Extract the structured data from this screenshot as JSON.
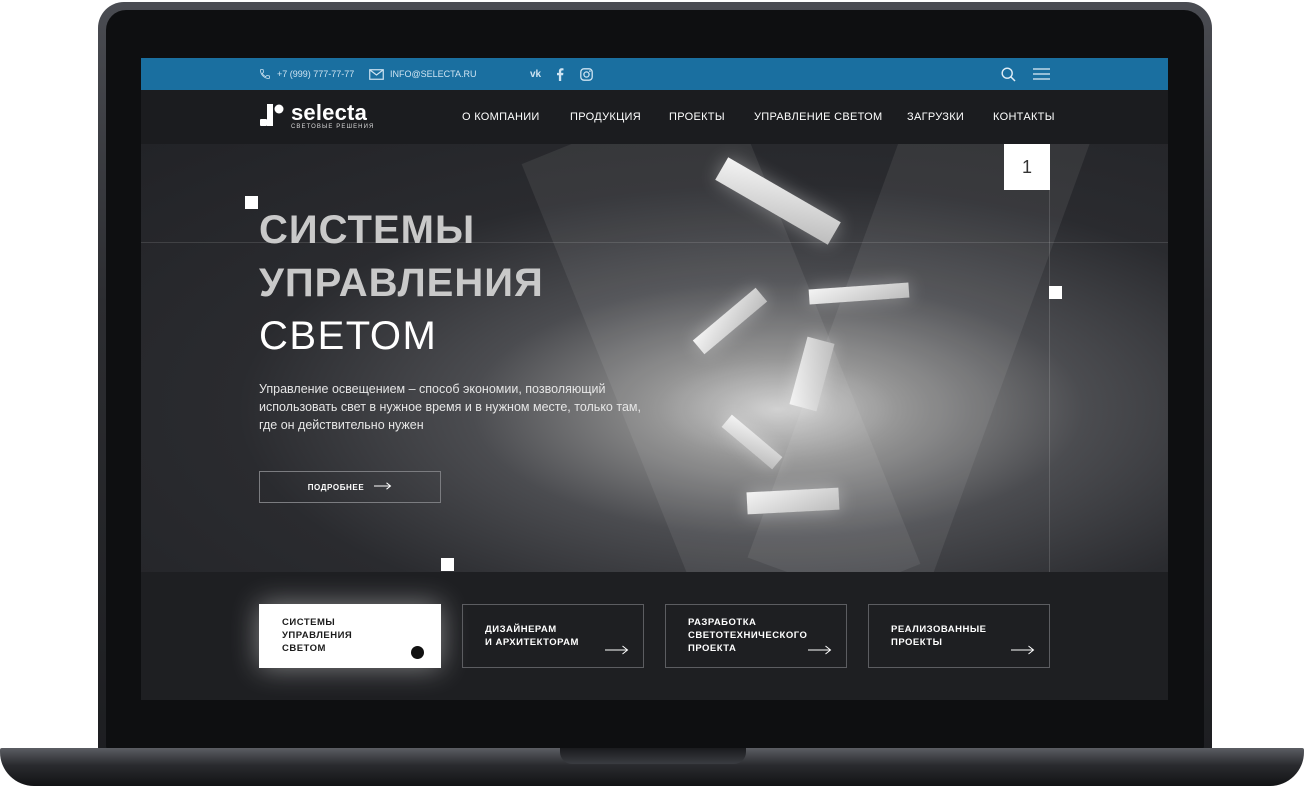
{
  "topbar": {
    "phone": "+7 (999) 777-77-77",
    "email": "INFO@SELECTA.RU",
    "social": [
      "vk-icon",
      "facebook-icon",
      "instagram-icon"
    ],
    "icons": [
      "search-icon",
      "menu-icon"
    ]
  },
  "brand": {
    "name": "selecta",
    "tagline": "СВЕТОВЫЕ РЕШЕНИЯ"
  },
  "nav": {
    "items": [
      {
        "label": "О КОМПАНИИ"
      },
      {
        "label": "ПРОДУКЦИЯ"
      },
      {
        "label": "ПРОЕКТЫ"
      },
      {
        "label": "УПРАВЛЕНИЕ СВЕТОМ"
      },
      {
        "label": "ЗАГРУЗКИ"
      },
      {
        "label": "КОНТАКТЫ"
      }
    ]
  },
  "hero": {
    "slide_number": "1",
    "title_line1": "СИСТЕМЫ",
    "title_line2": "УПРАВЛЕНИЯ",
    "title_line3": "СВЕТОМ",
    "description": "Управление освещением – способ экономии, позволяющий использовать свет в нужное время и в нужном месте, только там, где он действительно нужен",
    "button_label": "ПОДРОБНЕЕ"
  },
  "cards": [
    {
      "label": "СИСТЕМЫ\nУПРАВЛЕНИЯ\nСВЕТОМ",
      "active": true
    },
    {
      "label": "ДИЗАЙНЕРАМ\nИ АРХИТЕКТОРАМ",
      "active": false
    },
    {
      "label": "РАЗРАБОТКА\nСВЕТОТЕХНИЧЕСКОГО\nПРОЕКТА",
      "active": false
    },
    {
      "label": "РЕАЛИЗОВАННЫЕ\nПРОЕКТЫ",
      "active": false
    }
  ],
  "colors": {
    "topbar": "#1a6fa0",
    "navbar": "#1b1c1f",
    "screen_bg": "#222327",
    "accent_white": "#ffffff"
  }
}
